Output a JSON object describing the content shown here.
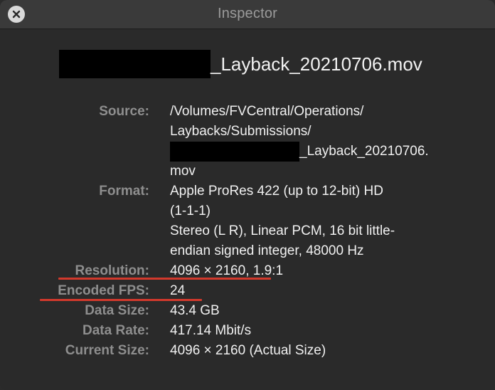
{
  "window": {
    "title": "Inspector",
    "close_icon": "close-icon"
  },
  "file": {
    "name_suffix": "_Layback_20210706.mov"
  },
  "properties": {
    "source": {
      "label": "Source:",
      "lines": [
        "/Volumes/FVCentral/Operations/",
        "Laybacks/Submissions/",
        "_Layback_20210706.",
        "mov"
      ]
    },
    "format": {
      "label": "Format:",
      "lines": [
        "Apple ProRes 422 (up to 12-bit) HD",
        "(1-1-1)",
        "Stereo (L R), Linear PCM, 16 bit little-",
        "endian signed integer, 48000 Hz"
      ]
    },
    "resolution": {
      "label": "Resolution:",
      "value": "4096 × 2160, 1.9:1"
    },
    "encoded_fps": {
      "label": "Encoded FPS:",
      "value": "24"
    },
    "data_size": {
      "label": "Data Size:",
      "value": "43.4 GB"
    },
    "data_rate": {
      "label": "Data Rate:",
      "value": "417.14 Mbit/s"
    },
    "current_size": {
      "label": "Current Size:",
      "value": "4096 × 2160 (Actual Size)"
    }
  },
  "colors": {
    "underline": "#d2392c",
    "label": "#8e8e8e",
    "value": "#f0f0f0"
  }
}
